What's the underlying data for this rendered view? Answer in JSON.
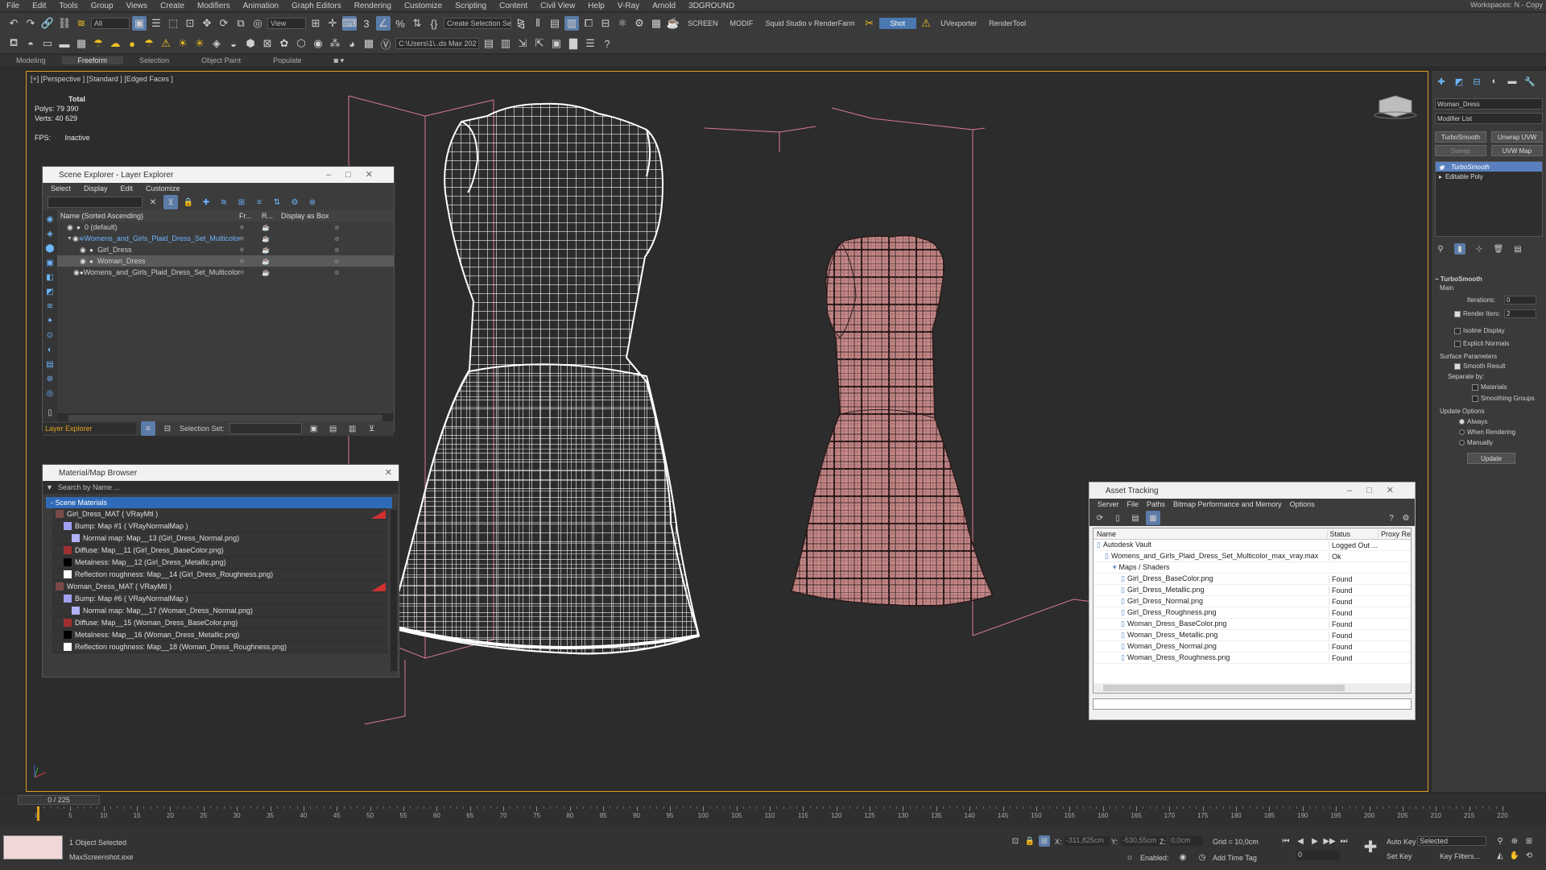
{
  "menubar": {
    "items": [
      "File",
      "Edit",
      "Tools",
      "Group",
      "Views",
      "Create",
      "Modifiers",
      "Animation",
      "Graph Editors",
      "Rendering",
      "Customize",
      "Scripting",
      "Content",
      "Civil View",
      "Help",
      "V-Ray",
      "Arnold",
      "3DGROUND"
    ],
    "workspace": "Workspaces: N - Copy"
  },
  "toolbar1": {
    "filter": "All",
    "refcoord": "View",
    "selection_set": "Create Selection Se",
    "screen_label": "SCREEN",
    "modif_label": "MODIF",
    "squid": "Squid Studio v RenderFarm",
    "shot": "Shot",
    "uvexporter": "UVexporter",
    "rendertool": "RenderTool"
  },
  "toolbar2": {
    "path": "C:\\Users\\1\\..ds Max 202"
  },
  "ribbon": {
    "tabs": [
      "Modeling",
      "Freeform",
      "Selection",
      "Object Paint",
      "Populate"
    ],
    "active": "Freeform"
  },
  "viewport": {
    "label": "[+] [Perspective ] [Standard ] [Edged Faces ]",
    "stats": {
      "total": "Total",
      "polys_label": "Polys:",
      "polys": "79 390",
      "verts_label": "Verts:",
      "verts": "40 629",
      "fps_label": "FPS:",
      "fps": "Inactive"
    }
  },
  "scene_explorer": {
    "title": "Scene Explorer - Layer Explorer",
    "menu": [
      "Select",
      "Display",
      "Edit",
      "Customize"
    ],
    "columns": [
      "Name (Sorted Ascending)",
      "Fr...",
      "R...",
      "Display as Box"
    ],
    "rows": [
      {
        "name": "0 (default)",
        "indent": 0
      },
      {
        "name": "Womens_and_Girls_Plaid_Dress_Set_Multicolor",
        "indent": 1
      },
      {
        "name": "Girl_Dress",
        "indent": 2
      },
      {
        "name": "Woman_Dress",
        "indent": 2
      },
      {
        "name": "Womens_and_Girls_Plaid_Dress_Set_Multicolor",
        "indent": 2
      }
    ],
    "footer_left": "Layer Explorer",
    "footer_selset": "Selection Set:"
  },
  "material_browser": {
    "title": "Material/Map Browser",
    "search": "Search by Name ...",
    "group": "- Scene Materials",
    "rows": [
      {
        "text": "Girl_Dress_MAT  ( VRayMtl )",
        "indent": 0,
        "swatch": "#7a4a4a"
      },
      {
        "text": "Bump: Map #1  ( VRayNormalMap )",
        "indent": 1,
        "swatch": "#a0a0f0"
      },
      {
        "text": "Normal map: Map__13 (Girl_Dress_Normal.png)",
        "indent": 2,
        "swatch": "#b0b0f8"
      },
      {
        "text": "Diffuse: Map__11 (Girl_Dress_BaseColor.png)",
        "indent": 1,
        "swatch": "#a03030"
      },
      {
        "text": "Metalness: Map__12 (Girl_Dress_Metallic.png)",
        "indent": 1,
        "swatch": "#000000"
      },
      {
        "text": "Reflection roughness: Map__14 (Girl_Dress_Roughness.png)",
        "indent": 1,
        "swatch": "#ffffff"
      },
      {
        "text": "Woman_Dress_MAT  ( VRayMtl )",
        "indent": 0,
        "swatch": "#7a4a4a"
      },
      {
        "text": "Bump: Map #6  ( VRayNormalMap )",
        "indent": 1,
        "swatch": "#a0a0f0"
      },
      {
        "text": "Normal map: Map__17 (Woman_Dress_Normal.png)",
        "indent": 2,
        "swatch": "#b0b0f8"
      },
      {
        "text": "Diffuse: Map__15 (Woman_Dress_BaseColor.png)",
        "indent": 1,
        "swatch": "#a03030"
      },
      {
        "text": "Metalness: Map__16 (Woman_Dress_Metallic.png)",
        "indent": 1,
        "swatch": "#000000"
      },
      {
        "text": "Reflection roughness: Map__18 (Woman_Dress_Roughness.png)",
        "indent": 1,
        "swatch": "#ffffff"
      }
    ]
  },
  "asset_tracking": {
    "title": "Asset Tracking",
    "menu": [
      "Server",
      "File",
      "Paths",
      "Bitmap Performance and Memory",
      "Options"
    ],
    "columns": [
      "Name",
      "Status",
      "Proxy Re"
    ],
    "rows": [
      {
        "name": "Autodesk Vault",
        "status": "Logged Out ...",
        "indent": 0
      },
      {
        "name": "Womens_and_Girls_Plaid_Dress_Set_Multicolor_max_vray.max",
        "status": "Ok",
        "indent": 1
      },
      {
        "name": "Maps / Shaders",
        "status": "",
        "indent": 2
      },
      {
        "name": "Girl_Dress_BaseColor.png",
        "status": "Found",
        "indent": 3
      },
      {
        "name": "Girl_Dress_Metallic.png",
        "status": "Found",
        "indent": 3
      },
      {
        "name": "Girl_Dress_Normal.png",
        "status": "Found",
        "indent": 3
      },
      {
        "name": "Girl_Dress_Roughness.png",
        "status": "Found",
        "indent": 3
      },
      {
        "name": "Woman_Dress_BaseColor.png",
        "status": "Found",
        "indent": 3
      },
      {
        "name": "Woman_Dress_Metallic.png",
        "status": "Found",
        "indent": 3
      },
      {
        "name": "Woman_Dress_Normal.png",
        "status": "Found",
        "indent": 3
      },
      {
        "name": "Woman_Dress_Roughness.png",
        "status": "Found",
        "indent": 3
      }
    ]
  },
  "command_panel": {
    "object_name": "Woman_Dress",
    "modifier_list": "Modifier List",
    "btn_turbosmooth": "TurboSmooth",
    "btn_unwrap": "Unwrap UVW",
    "btn_sweep": "Sweep",
    "btn_uvwmap": "UVW Map",
    "stack": [
      "TurboSmooth",
      "Editable Poly"
    ],
    "rollout": "TurboSmooth",
    "main": "Main",
    "iterations_label": "Iterations:",
    "iterations": "0",
    "render_iters_label": "Render Iters:",
    "render_iters": "2",
    "isoline": "Isoline Display",
    "explicit": "Explicit Normals",
    "surface_params": "Surface Parameters",
    "smooth_result": "Smooth Result",
    "separate_by": "Separate by:",
    "materials": "Materials",
    "smoothing_groups": "Smoothing Groups",
    "update_options": "Update Options",
    "always": "Always",
    "when_rendering": "When Rendering",
    "manually": "Manually",
    "update": "Update"
  },
  "timeline": {
    "frame": "0 / 225",
    "ticks": [
      "0",
      "5",
      "10",
      "15",
      "20",
      "25",
      "30",
      "35",
      "40",
      "45",
      "50",
      "55",
      "60",
      "65",
      "70",
      "75",
      "80",
      "85",
      "90",
      "95",
      "100",
      "105",
      "110",
      "115",
      "120",
      "125",
      "130",
      "135",
      "140",
      "145",
      "150",
      "155",
      "160",
      "165",
      "170",
      "175",
      "180",
      "185",
      "190",
      "195",
      "200",
      "205",
      "210",
      "215",
      "220"
    ]
  },
  "status": {
    "selected": "1 Object Selected",
    "script": "MaxScreenshot.exe",
    "x_label": "X:",
    "x": "-311,825cm",
    "y_label": "Y:",
    "y": "-530,55cm",
    "z_label": "Z:",
    "z": "0,0cm",
    "grid": "Grid = 10,0cm",
    "enabled": "Enabled:",
    "add_time_tag": "Add Time Tag",
    "auto_key": "Auto Key",
    "set_key": "Set Key",
    "selected_dd": "Selected",
    "key_filters": "Key Filters...",
    "frame_field": "0"
  }
}
